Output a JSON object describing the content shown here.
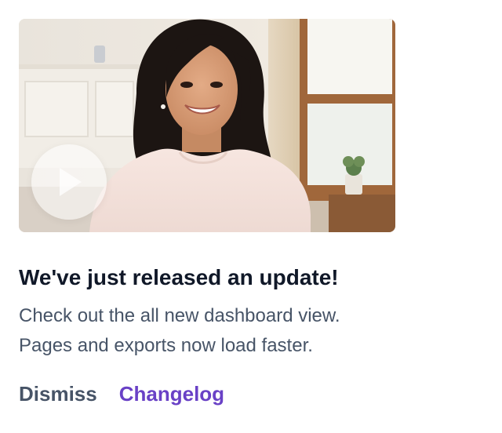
{
  "notification": {
    "media": {
      "alt": "Smiling woman in a bright room",
      "play_icon": "play-icon"
    },
    "title": "We've just released an update!",
    "description_lines": [
      "Check out the all new dashboard view.",
      "Pages and exports now load faster."
    ],
    "actions": {
      "dismiss_label": "Dismiss",
      "changelog_label": "Changelog"
    }
  },
  "colors": {
    "title": "#101828",
    "body": "#475467",
    "accent": "#6941c6"
  }
}
